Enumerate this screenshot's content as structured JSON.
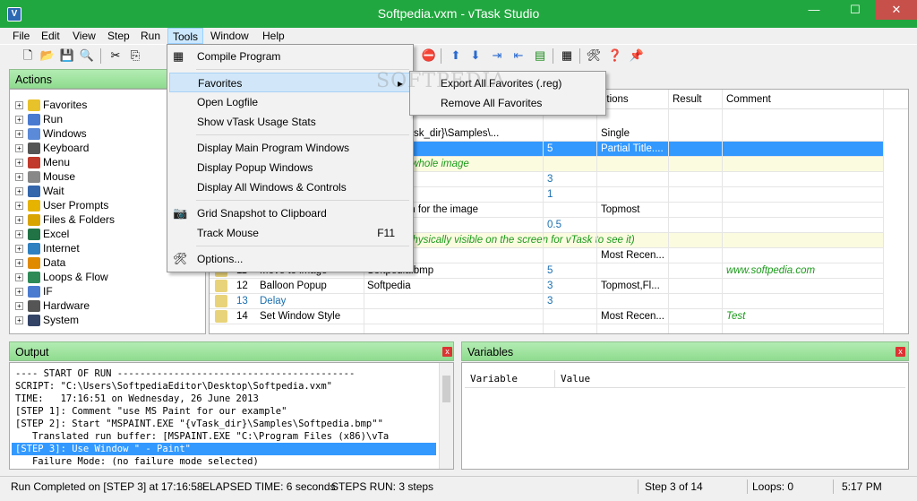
{
  "window": {
    "title": "Softpedia.vxm - vTask Studio",
    "app_icon_glyph": "V",
    "controls": {
      "minimize": "—",
      "maximize": "☐",
      "close": "✕"
    }
  },
  "menubar": [
    "File",
    "Edit",
    "View",
    "Step",
    "Run",
    "Tools",
    "Window",
    "Help"
  ],
  "actions": {
    "title": "Actions",
    "items": [
      {
        "label": "Favorites",
        "icon": "star-icon",
        "color": "#e8c22a"
      },
      {
        "label": "Run",
        "icon": "window-run-icon",
        "color": "#4a7bd1"
      },
      {
        "label": "Windows",
        "icon": "windows-icon",
        "color": "#5a8ad8"
      },
      {
        "label": "Keyboard",
        "icon": "keyboard-icon",
        "color": "#555555"
      },
      {
        "label": "Menu",
        "icon": "menu-icon",
        "color": "#c0392b"
      },
      {
        "label": "Mouse",
        "icon": "mouse-icon",
        "color": "#888888"
      },
      {
        "label": "Wait",
        "icon": "clock-icon",
        "color": "#3366aa"
      },
      {
        "label": "User Prompts",
        "icon": "chat-icon",
        "color": "#e6b400"
      },
      {
        "label": "Files & Folders",
        "icon": "folder-icon",
        "color": "#d9a400"
      },
      {
        "label": "Excel",
        "icon": "excel-icon",
        "color": "#217346"
      },
      {
        "label": "Internet",
        "icon": "globe-icon",
        "color": "#2f80c0"
      },
      {
        "label": "Data",
        "icon": "data-icon",
        "color": "#e08a00"
      },
      {
        "label": "Loops & Flow",
        "icon": "loop-icon",
        "color": "#2e8b57"
      },
      {
        "label": "IF",
        "icon": "check-icon",
        "color": "#4a7bd1"
      },
      {
        "label": "Hardware",
        "icon": "hardware-icon",
        "color": "#555555"
      },
      {
        "label": "System",
        "icon": "system-icon",
        "color": "#334466"
      }
    ]
  },
  "grid": {
    "headers": {
      "options": "ptions",
      "result": "Result",
      "comment": "Comment"
    },
    "rows": [
      {
        "step": "",
        "action": "",
        "param": "EXE \"{vTask_dir}\\Samples\\...",
        "result_val": "",
        "options": "Single",
        "comment": ""
      },
      {
        "step": "",
        "action": "",
        "param": "",
        "result_val": "5",
        "options": "Partial Title....",
        "comment": ""
      },
      {
        "step": "",
        "action": "",
        "param": "show the whole image",
        "result_val": "",
        "options": "",
        "comment": ""
      },
      {
        "step": "",
        "action": "",
        "param": "",
        "result_val": "3",
        "options": "",
        "comment": ""
      },
      {
        "step": "",
        "action": "",
        "param": "",
        "result_val": "1",
        "options": "",
        "comment": ""
      },
      {
        "step": "",
        "action": "",
        "param": "will search for the image",
        "result_val": "",
        "options": "Topmost",
        "comment": ""
      },
      {
        "step": "",
        "action": "",
        "param": "",
        "result_val": "0.5",
        "options": "",
        "comment": ""
      },
      {
        "step": "",
        "action": "",
        "param": "must be physically visible on the screen for vTask to see it)",
        "result_val": "",
        "options": "",
        "comment": ""
      },
      {
        "step": "",
        "action": "",
        "param": "",
        "result_val": "",
        "options": "Most Recen...",
        "comment": ""
      },
      {
        "step": "11",
        "action": "Move to image",
        "param": "Softpedia.bmp",
        "result_val": "5",
        "options": "",
        "comment": "www.softpedia.com"
      },
      {
        "step": "12",
        "action": "Balloon Popup",
        "param": "Softpedia",
        "result_val": "3",
        "options": "Topmost,Fl...",
        "comment": ""
      },
      {
        "step": "13",
        "action": "Delay",
        "param": "",
        "result_val": "3",
        "options": "",
        "comment": ""
      },
      {
        "step": "14",
        "action": "Set Window Style",
        "param": "",
        "result_val": "",
        "options": "Most Recen...",
        "comment": "Test"
      }
    ]
  },
  "output": {
    "title": "Output",
    "lines": [
      "---- START OF RUN ------------------------------------------",
      "SCRIPT: \"C:\\Users\\SoftpediaEditor\\Desktop\\Softpedia.vxm\"",
      "TIME:   17:16:51 on Wednesday, 26 June 2013",
      "[STEP 1]: Comment \"use MS Paint for our example\"",
      "[STEP 2]: Start \"MSPAINT.EXE \"{vTask_dir}\\Samples\\Softpedia.bmp\"\"",
      "   Translated run buffer: [MSPAINT.EXE \"C:\\Program Files (x86)\\vTa",
      "[STEP 3]: Use Window \" - Paint\"",
      "   Failure Mode: (no failure mode selected)"
    ]
  },
  "variables": {
    "title": "Variables",
    "columns": [
      "Variable",
      "Value"
    ]
  },
  "statusbar": {
    "status": "Run Completed on [STEP 3] at 17:16:58",
    "elapsed": "ELAPSED TIME: 6 seconds",
    "steps_run": "STEPS RUN: 3 steps",
    "step_pos": "Step 3 of 14",
    "loops": "Loops: 0",
    "clock": "5:17 PM"
  },
  "tools_menu": {
    "items": [
      {
        "label": "Compile Program",
        "shortcut": ""
      },
      {
        "label": "Favorites",
        "shortcut": "▸"
      },
      {
        "label": "Open Logfile",
        "shortcut": ""
      },
      {
        "label": "Show vTask Usage Stats",
        "shortcut": ""
      },
      {
        "label": "Display Main Program Windows",
        "shortcut": ""
      },
      {
        "label": "Display Popup Windows",
        "shortcut": ""
      },
      {
        "label": "Display All Windows & Controls",
        "shortcut": ""
      },
      {
        "label": "Grid Snapshot to Clipboard",
        "shortcut": ""
      },
      {
        "label": "Track Mouse",
        "shortcut": "F11"
      },
      {
        "label": "Options...",
        "shortcut": ""
      }
    ]
  },
  "favorites_submenu": {
    "items": [
      "Export All Favorites (.reg)",
      "Remove All Favorites"
    ]
  },
  "watermark": "SOFTPEDIA",
  "colors": {
    "title_bg": "#21a73f",
    "selected_row": "#3399ff",
    "panel_header": "#8fdb8f"
  }
}
